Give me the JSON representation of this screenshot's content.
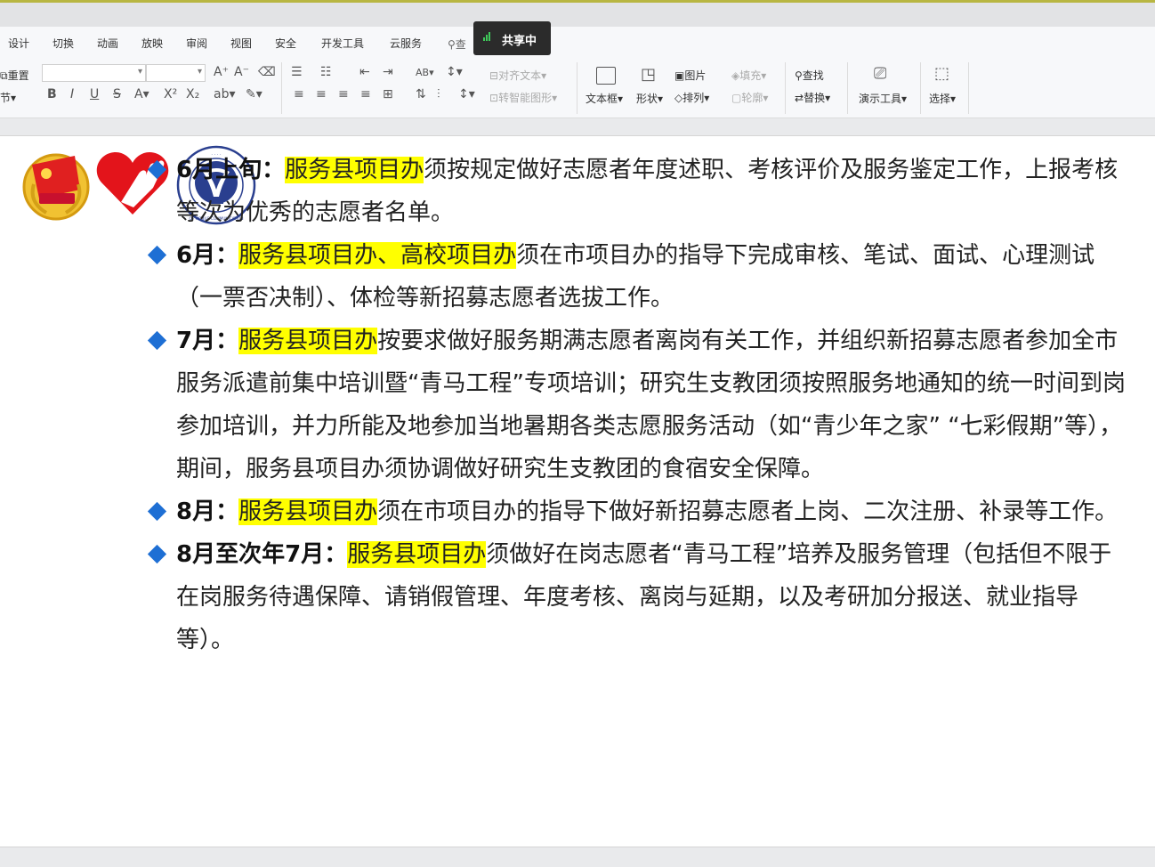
{
  "ribbon": {
    "tabs": [
      "设计",
      "切换",
      "动画",
      "放映",
      "审阅",
      "视图",
      "安全",
      "开发工具",
      "云服务"
    ],
    "search_label": "查",
    "sharing_label": "共享中",
    "row1": {
      "reset": "重置",
      "align_text": "对齐文本",
      "picture": "图片",
      "fill": "填充",
      "find": "查找"
    },
    "row2": {
      "section": "节",
      "smartart": "转智能图形",
      "arrange": "排列",
      "outline": "轮廓",
      "replace": "替换"
    },
    "big_buttons": {
      "textbox": "文本框",
      "shape": "形状",
      "present_tools": "演示工具",
      "select": "选择"
    }
  },
  "slide": {
    "logos": [
      "communist-youth-league-emblem",
      "volunteer-heart-hand-logo",
      "chongqing-university-of-mobile-communication-seal"
    ],
    "seal_text": "CHONGQING UNIVERSITY OF MOBILE COMMUNICATION",
    "seal_year": "2000",
    "items": [
      {
        "label": "6月上旬",
        "colon": "：",
        "highlight": "服务县项目办",
        "text": "须按规定做好志愿者年度述职、考核评价及服务鉴定工作，上报考核等次为优秀的志愿者名单。"
      },
      {
        "label": "6月",
        "colon": "：",
        "highlight": "服务县项目办、高校项目办",
        "text": "须在市项目办的指导下完成审核、笔试、面试、心理测试（一票否决制）、体检等新招募志愿者选拔工作。"
      },
      {
        "label": "7月",
        "colon": "：",
        "highlight": "服务县项目办",
        "text": "按要求做好服务期满志愿者离岗有关工作，并组织新招募志愿者参加全市服务派遣前集中培训暨“青马工程”专项培训；研究生支教团须按照服务地通知的统一时间到岗参加培训，并力所能及地参加当地暑期各类志愿服务活动（如“青少年之家”  “七彩假期”等），期间，服务县项目办须协调做好研究生支教团的食宿安全保障。"
      },
      {
        "label": "8月",
        "colon": "：",
        "highlight": "服务县项目办",
        "text": "须在市项目办的指导下做好新招募志愿者上岗、二次注册、补录等工作。"
      },
      {
        "label": "8月至次年7月",
        "colon": "：",
        "highlight": "服务县项目办",
        "text": "须做好在岗志愿者“青马工程”培养及服务管理（包括但不限于在岗服务待遇保障、请销假管理、年度考核、离岗与延期，以及考研加分报送、就业指导等）。"
      }
    ]
  },
  "colors": {
    "highlight": "#ffff00",
    "bullet": "#1e6fd4",
    "ribbon_bg": "#f7f8fa",
    "sharing_badge": "#2b2b2b"
  }
}
